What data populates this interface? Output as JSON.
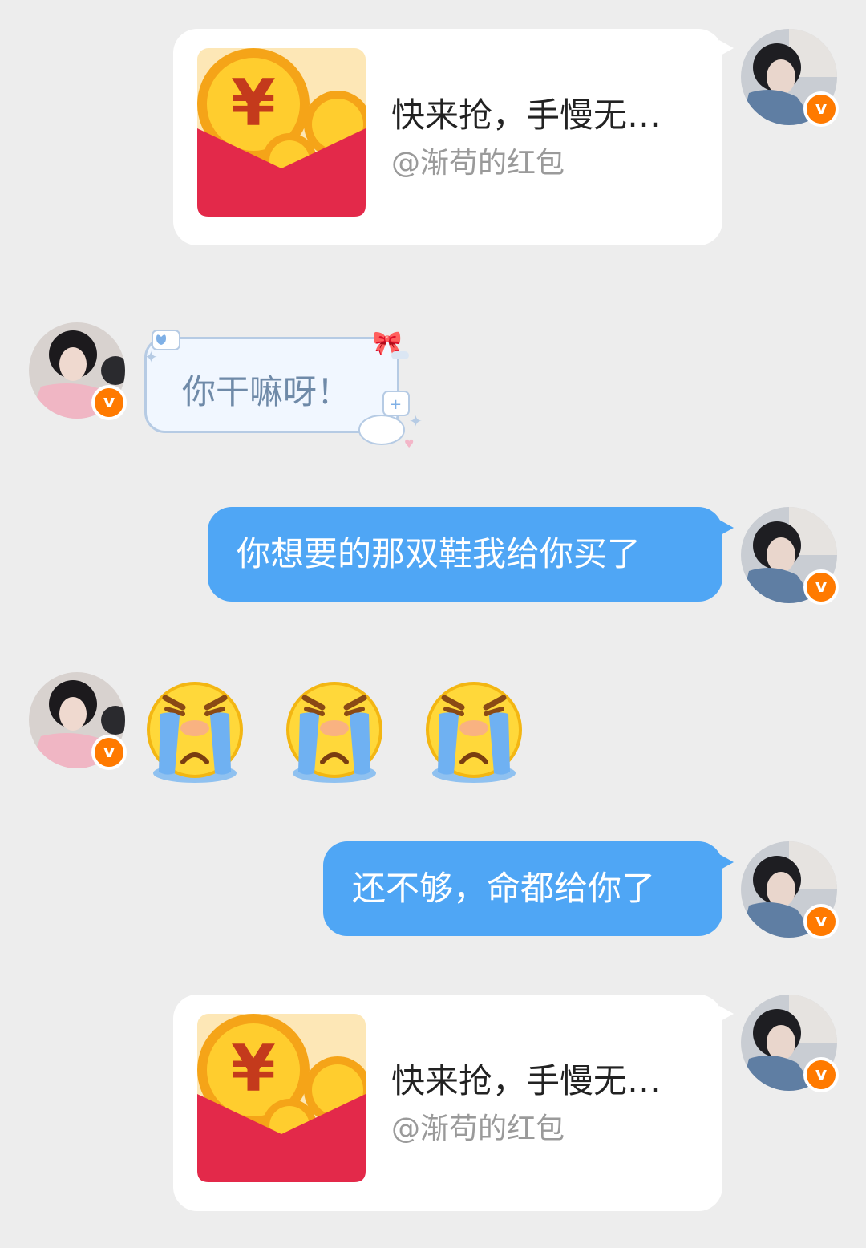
{
  "messages": [
    {
      "type": "red_packet",
      "side": "right",
      "title": "快来抢，手慢无…",
      "sender": "@渐苟的红包"
    },
    {
      "type": "text",
      "side": "left",
      "style": "cute",
      "text": "你干嘛呀！"
    },
    {
      "type": "text",
      "side": "right",
      "text": "你想要的那双鞋我给你买了"
    },
    {
      "type": "emoji",
      "side": "left",
      "emojis": [
        "crying-face",
        "crying-face",
        "crying-face"
      ]
    },
    {
      "type": "text",
      "side": "right",
      "text": "还不够，命都给你了"
    },
    {
      "type": "red_packet",
      "side": "right",
      "title": "快来抢，手慢无…",
      "sender": "@渐苟的红包"
    }
  ],
  "badge_letter": "v",
  "colors": {
    "background": "#ededed",
    "bubble_blue": "#4fa6f5",
    "badge_orange": "#ff7a00",
    "packet_red": "#e3294a"
  }
}
